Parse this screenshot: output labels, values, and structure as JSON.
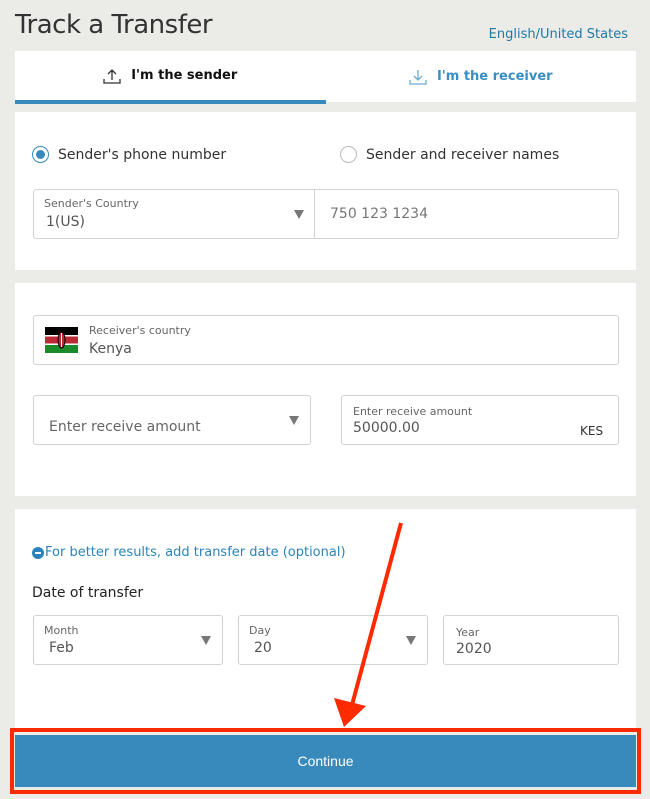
{
  "header": {
    "title": "Track a Transfer",
    "language": "English/United States"
  },
  "tabs": [
    {
      "label": "I'm the sender",
      "icon": "upload-icon",
      "active": true
    },
    {
      "label": "I'm the receiver",
      "icon": "download-icon",
      "active": false
    }
  ],
  "search_by": {
    "options": [
      {
        "label": "Sender's phone number",
        "selected": true
      },
      {
        "label": "Sender and receiver names",
        "selected": false
      }
    ]
  },
  "sender": {
    "country_label": "Sender's Country",
    "country_value": "1(US)",
    "phone_placeholder": "750 123 1234"
  },
  "receiver": {
    "country_label": "Receiver's country",
    "country_value": "Kenya",
    "amount_select_placeholder": "Enter receive amount",
    "amount_label": "Enter receive amount",
    "amount_value": "50000.00",
    "currency": "KES"
  },
  "date": {
    "toggle_label": "For better results, add transfer date (optional)",
    "title": "Date of transfer",
    "month_label": "Month",
    "month_value": "Feb",
    "day_label": "Day",
    "day_value": "20",
    "year_label": "Year",
    "year_value": "2020"
  },
  "continue_label": "Continue",
  "colors": {
    "accent": "#3889bc",
    "annotation": "#ff2a00",
    "background": "#ebebe7"
  }
}
